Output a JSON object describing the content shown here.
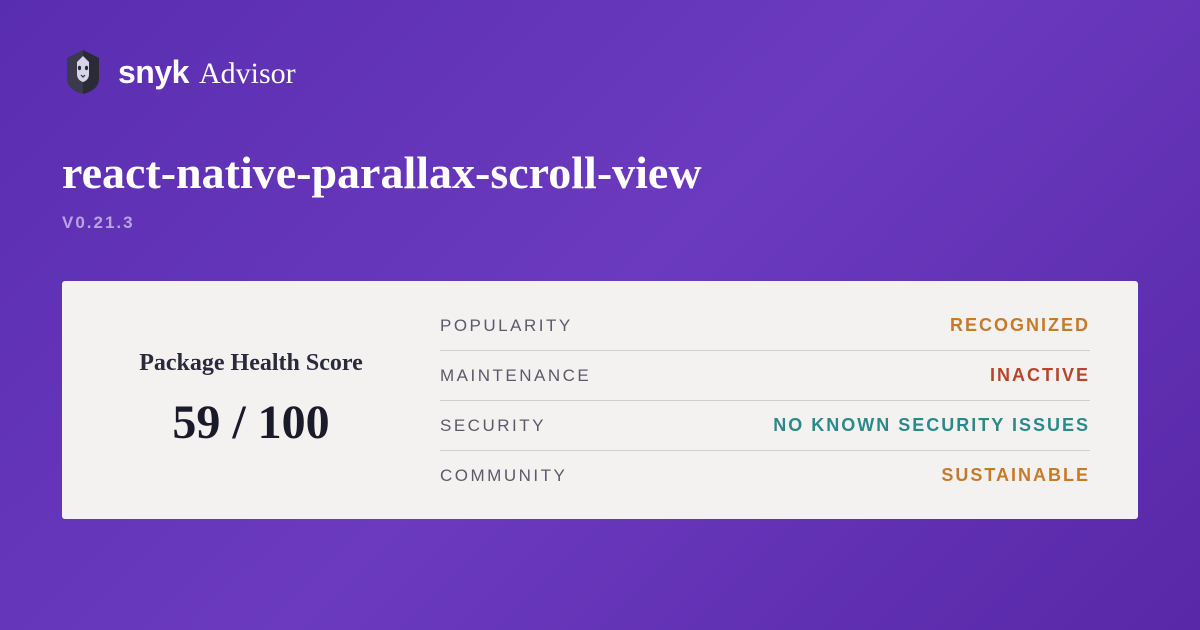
{
  "brand": {
    "name": "snyk",
    "sub": "Advisor"
  },
  "package": {
    "name": "react-native-parallax-scroll-view",
    "version": "V0.21.3"
  },
  "score": {
    "label": "Package Health Score",
    "value": "59 / 100"
  },
  "metrics": [
    {
      "label": "POPULARITY",
      "value": "RECOGNIZED",
      "cls": "c-recognized"
    },
    {
      "label": "MAINTENANCE",
      "value": "INACTIVE",
      "cls": "c-inactive"
    },
    {
      "label": "SECURITY",
      "value": "NO KNOWN SECURITY ISSUES",
      "cls": "c-security"
    },
    {
      "label": "COMMUNITY",
      "value": "SUSTAINABLE",
      "cls": "c-sustainable"
    }
  ]
}
